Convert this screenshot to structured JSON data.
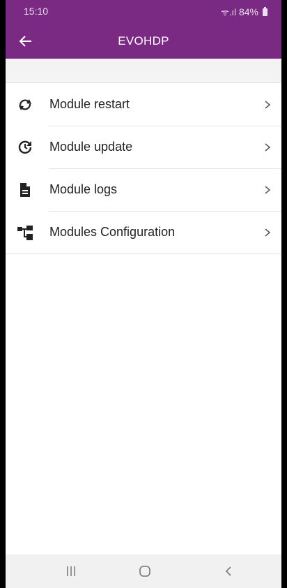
{
  "status_bar": {
    "time": "15:10",
    "signal_text": "ᯤ.ıl",
    "battery_percent": "84%"
  },
  "app_bar": {
    "title": "EVOHDP",
    "background_color": "#7b2a83",
    "back_icon": "arrow-left-icon"
  },
  "menu": {
    "items": [
      {
        "label": "Module restart",
        "icon": "restart-icon"
      },
      {
        "label": "Module update",
        "icon": "update-icon"
      },
      {
        "label": "Module logs",
        "icon": "document-icon"
      },
      {
        "label": "Modules Configuration",
        "icon": "hierarchy-icon"
      }
    ],
    "chevron_icon": "chevron-right-icon"
  },
  "nav_bar": {
    "buttons": [
      "recent-apps-icon",
      "home-icon",
      "back-icon"
    ]
  }
}
